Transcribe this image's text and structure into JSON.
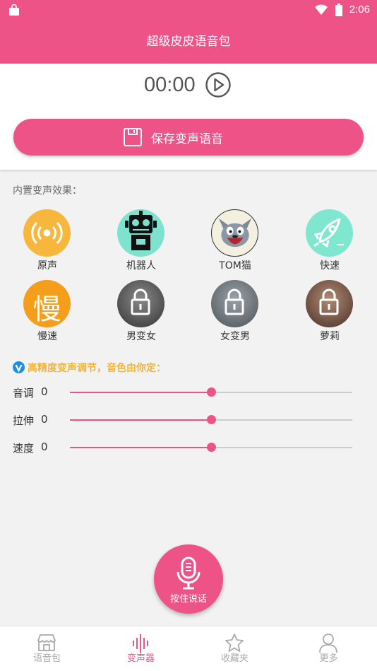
{
  "status_bar": {
    "time": "2:06"
  },
  "header": {
    "title": "超级皮皮语音包"
  },
  "player": {
    "time": "00:00",
    "save_label": "保存变声语音"
  },
  "effects": {
    "section_label": "内置变声效果：",
    "items": [
      {
        "label": "原声",
        "icon": "broadcast-icon",
        "color": "#f6b73c"
      },
      {
        "label": "机器人",
        "icon": "robot-icon",
        "color": "#7de3cf"
      },
      {
        "label": "TOM猫",
        "icon": "tom-cat-icon",
        "color": "#f3f0e0"
      },
      {
        "label": "快速",
        "icon": "rocket-icon",
        "color": "#7fe6cf"
      },
      {
        "label": "慢速",
        "icon": "slow-icon",
        "icon_text": "慢",
        "color": "#f59e1c"
      },
      {
        "label": "男变女",
        "icon": "locked-avatar",
        "color": "#555555"
      },
      {
        "label": "女变男",
        "icon": "locked-avatar",
        "color": "#6b7277"
      },
      {
        "label": "萝莉",
        "icon": "locked-avatar",
        "color": "#6b4b3c"
      }
    ]
  },
  "tuning": {
    "hint": "高精度变声调节，音色由你定：",
    "sliders": [
      {
        "name": "音调",
        "value": "0",
        "position": 0.5
      },
      {
        "name": "拉伸",
        "value": "0",
        "position": 0.5
      },
      {
        "name": "速度",
        "value": "0",
        "position": 0.5
      }
    ]
  },
  "talk_button": {
    "label": "按住说话"
  },
  "bottom_nav": {
    "items": [
      {
        "label": "语音包",
        "icon": "shop-icon"
      },
      {
        "label": "变声器",
        "icon": "waveform-icon",
        "active": true
      },
      {
        "label": "收藏夹",
        "icon": "star-icon"
      },
      {
        "label": "更多",
        "icon": "person-icon"
      }
    ]
  },
  "colors": {
    "accent": "#ee5388",
    "hint": "#f0b43a"
  }
}
